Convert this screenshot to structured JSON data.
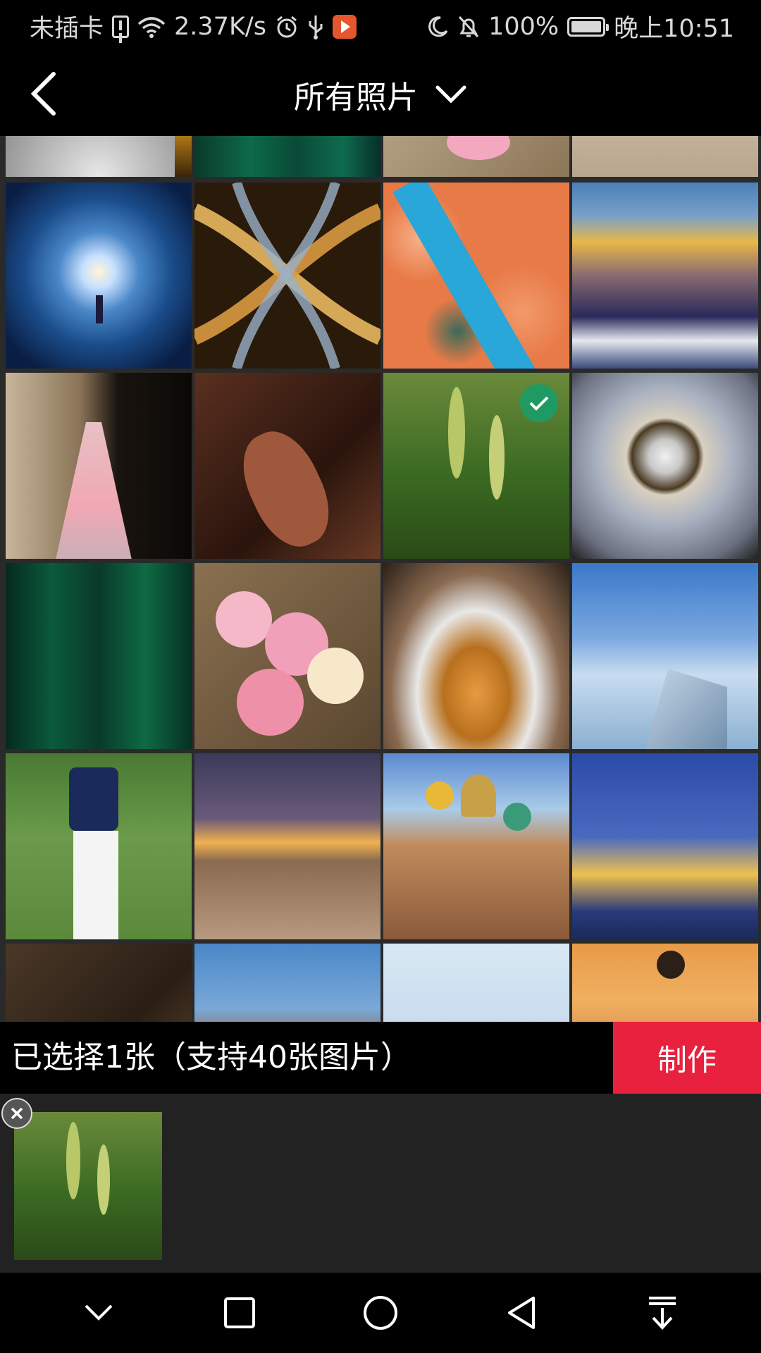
{
  "status_bar": {
    "carrier": "未插卡",
    "net_speed": "2.37K/s",
    "battery": "100%",
    "time": "晚上10:51"
  },
  "header": {
    "title": "所有照片"
  },
  "grid": {
    "photos": [
      {
        "name": "ceiling-dome-top",
        "selected": false
      },
      {
        "name": "bamboo-top",
        "selected": false
      },
      {
        "name": "roses-top",
        "selected": false
      },
      {
        "name": "interior-top",
        "selected": false
      },
      {
        "name": "ice-cave",
        "selected": false
      },
      {
        "name": "highway-interchange",
        "selected": false
      },
      {
        "name": "aerial-forest-river",
        "selected": false
      },
      {
        "name": "golden-mountains",
        "selected": false
      },
      {
        "name": "lace-dress",
        "selected": false
      },
      {
        "name": "violin",
        "selected": false
      },
      {
        "name": "wheat",
        "selected": true
      },
      {
        "name": "spiral-ceiling",
        "selected": false
      },
      {
        "name": "bamboo",
        "selected": false
      },
      {
        "name": "roses-box",
        "selected": false
      },
      {
        "name": "spiral-stairs",
        "selected": false
      },
      {
        "name": "airplane-skyscrapers",
        "selected": false
      },
      {
        "name": "golfer",
        "selected": false
      },
      {
        "name": "night-temple",
        "selected": false
      },
      {
        "name": "church-domes",
        "selected": false
      },
      {
        "name": "parliament-night",
        "selected": false
      },
      {
        "name": "rock-cliff",
        "selected": false
      },
      {
        "name": "modern-building",
        "selected": false
      },
      {
        "name": "chinese-temple-roof",
        "selected": false
      },
      {
        "name": "sunset-tree",
        "selected": false
      }
    ]
  },
  "selection": {
    "summary": "已选择1张（支持40张图片）",
    "make_label": "制作"
  },
  "colors": {
    "accent": "#e8213f",
    "check": "#1f9a63"
  }
}
